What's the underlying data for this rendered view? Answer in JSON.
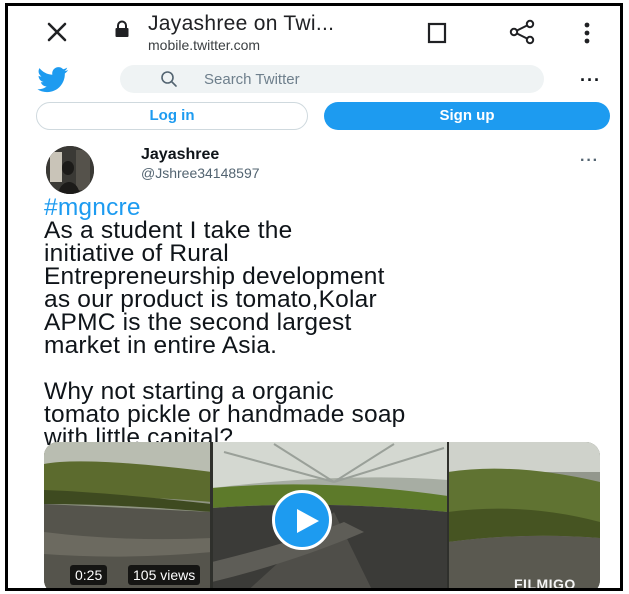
{
  "browser": {
    "title": "Jayashree on Twi...",
    "url": "mobile.twitter.com",
    "icons": {
      "close": "close-icon",
      "lock": "lock-icon",
      "bookmark": "bookmark-icon",
      "share": "share-icon",
      "menu": "kebab-menu-icon"
    }
  },
  "header": {
    "logo": "twitter-bird-icon",
    "search_placeholder": "Search Twitter",
    "more": "···"
  },
  "auth": {
    "login_label": "Log in",
    "signup_label": "Sign up"
  },
  "tweet": {
    "author_name": "Jayashree",
    "author_handle": "@Jshree34148597",
    "more": "···",
    "hashtag": "#mgncre",
    "paragraph1": "   As a student I take the\ninitiative of Rural\nEntrepreneurship development\nas our product is tomato,Kolar\nAPMC is the second largest\nmarket in entire Asia.",
    "paragraph2": "  Why not starting a organic\ntomato pickle or handmade soap\nwith little capital?",
    "video": {
      "duration": "0:25",
      "views": "105 views",
      "watermark": "FILMIGO"
    }
  },
  "colors": {
    "twitter_blue": "#1d9bf0",
    "search_bg": "#eff3f4",
    "text_primary": "#0f1419",
    "text_secondary": "#536471"
  }
}
